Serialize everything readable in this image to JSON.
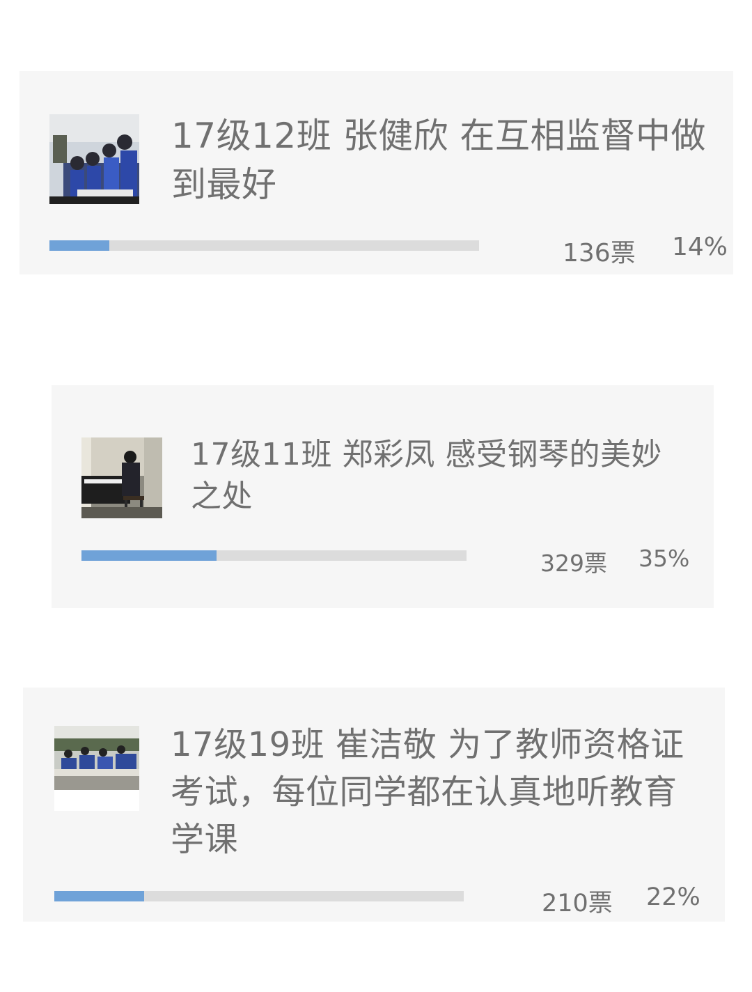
{
  "accent_color": "#6fa2d8",
  "track_color": "#dcdcdc",
  "entries": [
    {
      "title": "17级12班  张健欣  在互相监督中做到最好",
      "votes": "136票",
      "percent": "14%",
      "progress": 0.14,
      "thumbnail": "photo-students-at-keyboard"
    },
    {
      "title": "17级11班  郑彩凤  感受钢琴的美妙之处",
      "votes": "329票",
      "percent": "35%",
      "progress": 0.35,
      "thumbnail": "photo-student-at-piano"
    },
    {
      "title": "17级19班  崔洁敬  为了教师资格证考试，每位同学都在认真地听教育学课",
      "votes": "210票",
      "percent": "22%",
      "progress": 0.22,
      "thumbnail": "photo-classroom-lecture"
    }
  ]
}
